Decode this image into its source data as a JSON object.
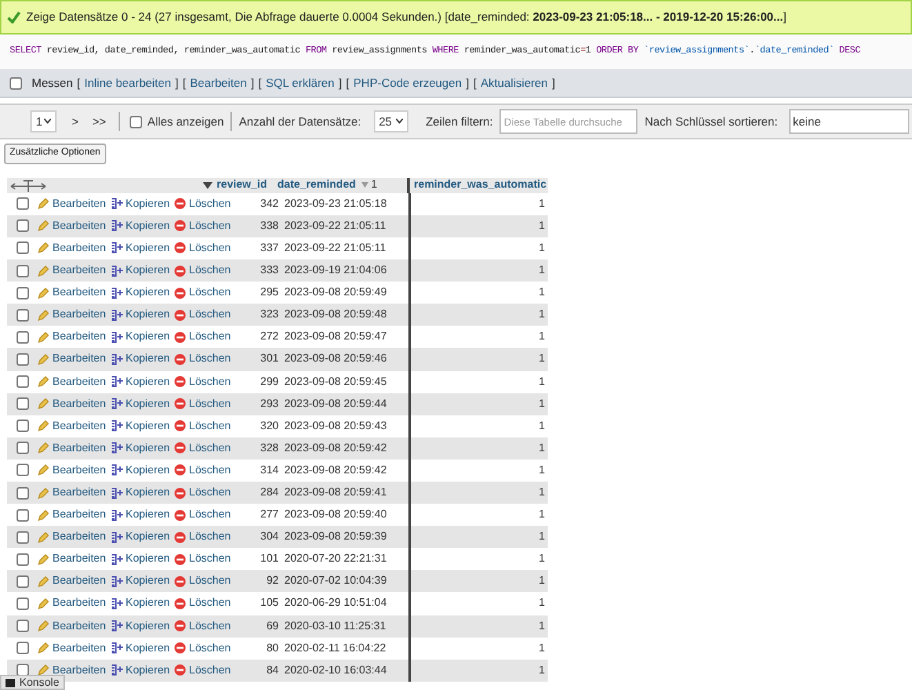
{
  "success": {
    "text": "Zeige Datensätze 0 - 24 (27 insgesamt, Die Abfrage dauerte 0.0004 Sekunden.) [date_reminded: **2023-09-23 21:05:18... - 2019-12-20 15:26:00...**]"
  },
  "sql": [
    {
      "kind": "kw",
      "text": "SELECT"
    },
    {
      "kind": "plain",
      "text": " review_id, date_reminded, reminder_was_automatic "
    },
    {
      "kind": "kw",
      "text": "FROM"
    },
    {
      "kind": "plain",
      "text": " review_assignments "
    },
    {
      "kind": "kw",
      "text": "WHERE"
    },
    {
      "kind": "plain",
      "text": " reminder_was_automatic"
    },
    {
      "kind": "op",
      "text": "="
    },
    {
      "kind": "plain",
      "text": "1 "
    },
    {
      "kind": "kw",
      "text": "ORDER BY "
    },
    {
      "kind": "ident",
      "text": "`review_assignments`"
    },
    {
      "kind": "plain",
      "text": "."
    },
    {
      "kind": "ident",
      "text": "`date_reminded` "
    },
    {
      "kind": "kw",
      "text": "DESC"
    }
  ],
  "profiling": {
    "label": "Messen",
    "checked": false,
    "links": [
      {
        "open": "[",
        "label": "Inline bearbeiten",
        "close": "]"
      },
      {
        "open": "[",
        "label": "Bearbeiten",
        "close": "]"
      },
      {
        "open": "[",
        "label": "SQL erklären",
        "close": "]"
      },
      {
        "open": "[",
        "label": "PHP-Code erzeugen",
        "close": "]"
      },
      {
        "open": "[",
        "label": "Aktualisieren",
        "close": "]"
      }
    ]
  },
  "navigation": {
    "page": "1",
    "next": ">",
    "last": ">>",
    "show_all": {
      "label": "Alles anzeigen",
      "checked": false
    },
    "rows_label": "Anzahl der Datensätze:",
    "rows_value": "25",
    "filter_label": "Zeilen filtern:",
    "filter_placeholder": "Diese Tabelle durchsuche",
    "sort_label": "Nach Schlüssel sortieren:",
    "sort_value": "keine"
  },
  "options_button": "Zusätzliche Optionen",
  "table": {
    "columns": [
      {
        "label": "review_id"
      },
      {
        "label": "date_reminded",
        "sort_order": "1"
      },
      {
        "label": "reminder_was_automatic"
      }
    ],
    "rows": [
      {
        "actions": [
          "Bearbeiten",
          "Kopieren",
          "Löschen"
        ],
        "review_id": "342",
        "date_reminded": "2023-09-23 21:05:18",
        "reminder_was_automatic": "1",
        "checked": false
      },
      {
        "actions": [
          "Bearbeiten",
          "Kopieren",
          "Löschen"
        ],
        "review_id": "338",
        "date_reminded": "2023-09-22 21:05:11",
        "reminder_was_automatic": "1",
        "checked": false
      },
      {
        "actions": [
          "Bearbeiten",
          "Kopieren",
          "Löschen"
        ],
        "review_id": "337",
        "date_reminded": "2023-09-22 21:05:11",
        "reminder_was_automatic": "1",
        "checked": false
      },
      {
        "actions": [
          "Bearbeiten",
          "Kopieren",
          "Löschen"
        ],
        "review_id": "333",
        "date_reminded": "2023-09-19 21:04:06",
        "reminder_was_automatic": "1",
        "checked": false
      },
      {
        "actions": [
          "Bearbeiten",
          "Kopieren",
          "Löschen"
        ],
        "review_id": "295",
        "date_reminded": "2023-09-08 20:59:49",
        "reminder_was_automatic": "1",
        "checked": false
      },
      {
        "actions": [
          "Bearbeiten",
          "Kopieren",
          "Löschen"
        ],
        "review_id": "323",
        "date_reminded": "2023-09-08 20:59:48",
        "reminder_was_automatic": "1",
        "checked": false
      },
      {
        "actions": [
          "Bearbeiten",
          "Kopieren",
          "Löschen"
        ],
        "review_id": "272",
        "date_reminded": "2023-09-08 20:59:47",
        "reminder_was_automatic": "1",
        "checked": false
      },
      {
        "actions": [
          "Bearbeiten",
          "Kopieren",
          "Löschen"
        ],
        "review_id": "301",
        "date_reminded": "2023-09-08 20:59:46",
        "reminder_was_automatic": "1",
        "checked": false
      },
      {
        "actions": [
          "Bearbeiten",
          "Kopieren",
          "Löschen"
        ],
        "review_id": "299",
        "date_reminded": "2023-09-08 20:59:45",
        "reminder_was_automatic": "1",
        "checked": false
      },
      {
        "actions": [
          "Bearbeiten",
          "Kopieren",
          "Löschen"
        ],
        "review_id": "293",
        "date_reminded": "2023-09-08 20:59:44",
        "reminder_was_automatic": "1",
        "checked": false
      },
      {
        "actions": [
          "Bearbeiten",
          "Kopieren",
          "Löschen"
        ],
        "review_id": "320",
        "date_reminded": "2023-09-08 20:59:43",
        "reminder_was_automatic": "1",
        "checked": false
      },
      {
        "actions": [
          "Bearbeiten",
          "Kopieren",
          "Löschen"
        ],
        "review_id": "328",
        "date_reminded": "2023-09-08 20:59:42",
        "reminder_was_automatic": "1",
        "checked": false
      },
      {
        "actions": [
          "Bearbeiten",
          "Kopieren",
          "Löschen"
        ],
        "review_id": "314",
        "date_reminded": "2023-09-08 20:59:42",
        "reminder_was_automatic": "1",
        "checked": false
      },
      {
        "actions": [
          "Bearbeiten",
          "Kopieren",
          "Löschen"
        ],
        "review_id": "284",
        "date_reminded": "2023-09-08 20:59:41",
        "reminder_was_automatic": "1",
        "checked": false
      },
      {
        "actions": [
          "Bearbeiten",
          "Kopieren",
          "Löschen"
        ],
        "review_id": "277",
        "date_reminded": "2023-09-08 20:59:40",
        "reminder_was_automatic": "1",
        "checked": false
      },
      {
        "actions": [
          "Bearbeiten",
          "Kopieren",
          "Löschen"
        ],
        "review_id": "304",
        "date_reminded": "2023-09-08 20:59:39",
        "reminder_was_automatic": "1",
        "checked": false
      },
      {
        "actions": [
          "Bearbeiten",
          "Kopieren",
          "Löschen"
        ],
        "review_id": "101",
        "date_reminded": "2020-07-20 22:21:31",
        "reminder_was_automatic": "1",
        "checked": false
      },
      {
        "actions": [
          "Bearbeiten",
          "Kopieren",
          "Löschen"
        ],
        "review_id": "92",
        "date_reminded": "2020-07-02 10:04:39",
        "reminder_was_automatic": "1",
        "checked": false
      },
      {
        "actions": [
          "Bearbeiten",
          "Kopieren",
          "Löschen"
        ],
        "review_id": "105",
        "date_reminded": "2020-06-29 10:51:04",
        "reminder_was_automatic": "1",
        "checked": false
      },
      {
        "actions": [
          "Bearbeiten",
          "Kopieren",
          "Löschen"
        ],
        "review_id": "69",
        "date_reminded": "2020-03-10 11:25:31",
        "reminder_was_automatic": "1",
        "checked": false
      },
      {
        "actions": [
          "Bearbeiten",
          "Kopieren",
          "Löschen"
        ],
        "review_id": "80",
        "date_reminded": "2020-02-11 16:04:22",
        "reminder_was_automatic": "1",
        "checked": false
      },
      {
        "actions": [
          "Bearbeiten",
          "Kopieren",
          "Löschen"
        ],
        "review_id": "84",
        "date_reminded": "2020-02-10 16:03:44",
        "reminder_was_automatic": "1",
        "checked": false
      }
    ]
  },
  "console": {
    "label": "Konsole"
  }
}
